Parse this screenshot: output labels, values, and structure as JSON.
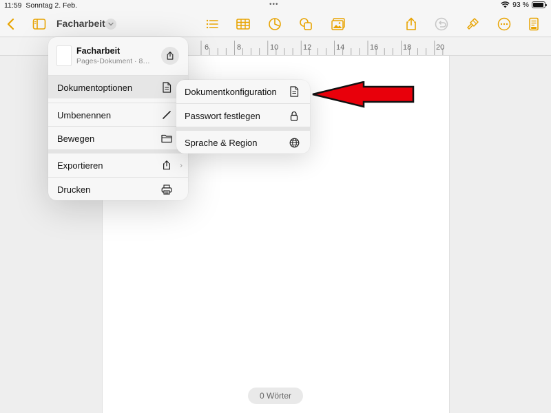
{
  "status_bar": {
    "time": "11:59",
    "date": "Sonntag 2. Feb.",
    "battery": "93 %",
    "battery_level": 0.93
  },
  "toolbar": {
    "document_title": "Facharbeit",
    "left_icons": [
      "back-chevron-icon",
      "sidebar-icon"
    ],
    "center_icons": [
      "list-icon",
      "table-icon",
      "chart-icon",
      "shapes-icon",
      "media-icon"
    ],
    "right_icons": [
      "share-icon",
      "undo-icon",
      "format-brush-icon",
      "more-icon",
      "document-setup-icon"
    ],
    "accent_color": "#e8a300"
  },
  "ruler": {
    "labels": [
      "6",
      "8",
      "10",
      "12",
      "14",
      "16",
      "18",
      "20"
    ]
  },
  "file_menu": {
    "document_name": "Facharbeit",
    "document_info": "Pages-Dokument · 88…",
    "items": [
      {
        "label": "Dokumentoptionen",
        "icon": "document-icon"
      },
      {
        "label": "Umbenennen",
        "icon": "pencil-icon"
      },
      {
        "label": "Bewegen",
        "icon": "folder-icon"
      },
      {
        "label": "Exportieren",
        "icon": "export-icon"
      },
      {
        "label": "Drucken",
        "icon": "printer-icon"
      }
    ]
  },
  "document_options_submenu": {
    "items": [
      {
        "label": "Dokumentkonfiguration",
        "icon": "document-icon"
      },
      {
        "label": "Passwort festlegen",
        "icon": "lock-icon"
      },
      {
        "label": "Sprache & Region",
        "icon": "globe-icon"
      }
    ]
  },
  "annotation": {
    "arrow_color": "#e8000b",
    "direction": "left"
  },
  "word_count": "0 Wörter"
}
